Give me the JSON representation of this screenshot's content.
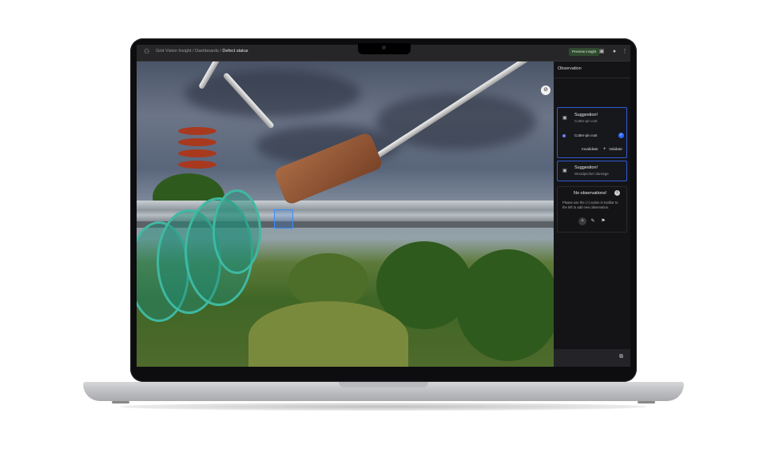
{
  "app": {
    "name": "Grid Vision Insight",
    "breadcrumb": [
      "Grid Vision Insight",
      "Dashboards",
      "Defect status"
    ],
    "preview_button": "Preview insight"
  },
  "toolbar_icons": [
    "calendar-icon",
    "account-icon",
    "more-vert-icon"
  ],
  "panel": {
    "title": "Observation",
    "suggestions": [
      {
        "heading": "Suggestion!",
        "subtitle": "Cotter-pin rust",
        "option_label": "Cotter-pin rust",
        "invalidate_label": "Invalidate",
        "validate_label": "Validate",
        "expanded": true
      },
      {
        "heading": "Suggestion!",
        "subtitle": "Woodpecker damage",
        "expanded": false
      }
    ],
    "empty": {
      "heading": "No observations!",
      "text": "Please use the (+) action in toolbar to the left to add new observation."
    }
  },
  "colors": {
    "accent": "#2f6bff",
    "panel_bg": "#141416",
    "card_border": "#2f5bd8"
  }
}
